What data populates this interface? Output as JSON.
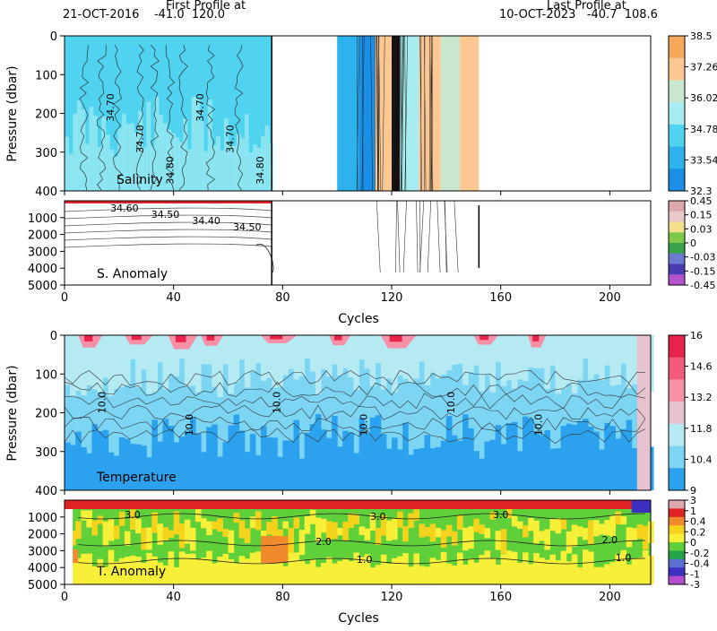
{
  "header": {
    "first_title": "First Profile at",
    "first_info": "21-OCT-2016    -41.0  120.0",
    "last_title": "Last Profile at",
    "last_info": "10-OCT-2023   -40.7  108.6"
  },
  "chart_data": [
    {
      "type": "heatmap",
      "panel": "Salinity",
      "label": "Salinity",
      "ylabel": "Pressure (dbar)",
      "xlim": [
        0,
        215
      ],
      "ylim": [
        400,
        0
      ],
      "y_ticks": [
        "0",
        "100",
        "200",
        "300",
        "400"
      ],
      "colorbar_ticks": [
        "38.5",
        "37.26",
        "36.02",
        "34.78",
        "33.54",
        "32.3"
      ],
      "colorbar_colors": [
        "#f7a85c",
        "#fbc793",
        "#c9e6cf",
        "#a7ecf0",
        "#4fd3ef",
        "#2db2ee",
        "#1b8fe6"
      ],
      "contour_labels": [
        "34.70",
        "34.70",
        "34.80",
        "34.70",
        "34.70",
        "34.80"
      ],
      "segments": [
        {
          "from": 0,
          "to": 76,
          "level": "34.7"
        },
        {
          "from": 100,
          "to": 152,
          "level": "mixed"
        }
      ]
    },
    {
      "type": "heatmap",
      "panel": "S. Anomaly",
      "label": "S. Anomaly",
      "ylim": [
        5000,
        0
      ],
      "y_ticks": [
        "1000",
        "2000",
        "3000",
        "4000",
        "5000"
      ],
      "colorbar_ticks": [
        "0.45",
        "0.15",
        "0.03",
        "0",
        "-0.03",
        "-0.15",
        "-0.45"
      ],
      "colorbar_colors": [
        "#dca8ad",
        "#e8c8cb",
        "#f3e08a",
        "#7fc94a",
        "#3ca24a",
        "#6a7bd0",
        "#4b3bb0",
        "#b254cc"
      ],
      "contour_labels": [
        "34.60",
        "34.50",
        "34.40",
        "34.50"
      ]
    },
    {
      "type": "heatmap",
      "panel": "Temperature",
      "label": "Temperature",
      "ylabel": "Pressure (dbar)",
      "xlabel": "Cycles",
      "xlim": [
        0,
        215
      ],
      "ylim": [
        400,
        0
      ],
      "y_ticks": [
        "0",
        "100",
        "200",
        "300",
        "400"
      ],
      "colorbar_ticks": [
        "16",
        "14.6",
        "13.2",
        "11.8",
        "10.4",
        "9"
      ],
      "colorbar_colors": [
        "#e8224a",
        "#f25c7a",
        "#f590a6",
        "#e7c3cf",
        "#b6eaf3",
        "#7cd5f3",
        "#2ca2ef"
      ],
      "contour_labels": [
        "10.0",
        "10.0",
        "10.0",
        "10.0",
        "10.0",
        "10.0"
      ],
      "warm_cycles": [
        5,
        22,
        38,
        50,
        72,
        97,
        116,
        150,
        170
      ]
    },
    {
      "type": "heatmap",
      "panel": "T. Anomaly",
      "label": "T. Anomaly",
      "xlabel": "Cycles",
      "xlim": [
        0,
        215
      ],
      "ylim": [
        5000,
        0
      ],
      "y_ticks": [
        "1000",
        "2000",
        "3000",
        "4000",
        "5000"
      ],
      "x_ticks": [
        "0",
        "40",
        "80",
        "120",
        "160",
        "200"
      ],
      "colorbar_ticks": [
        "3",
        "1",
        "0.4",
        "0.2",
        "0",
        "-0.2",
        "-0.4",
        "-1",
        "-3"
      ],
      "colorbar_colors": [
        "#dca8ad",
        "#e02424",
        "#f08a2c",
        "#f5d21c",
        "#f7ef38",
        "#5fd03a",
        "#21a548",
        "#5a6fd1",
        "#3d2fbf",
        "#b24fd0"
      ],
      "contour_labels": [
        "3.0",
        "3.0",
        "3.0",
        "2.0",
        "2.0",
        "1.0",
        "1.0"
      ]
    }
  ],
  "axes": {
    "x_ticks": [
      "0",
      "40",
      "80",
      "120",
      "160",
      "200"
    ],
    "xlabel": "Cycles"
  }
}
